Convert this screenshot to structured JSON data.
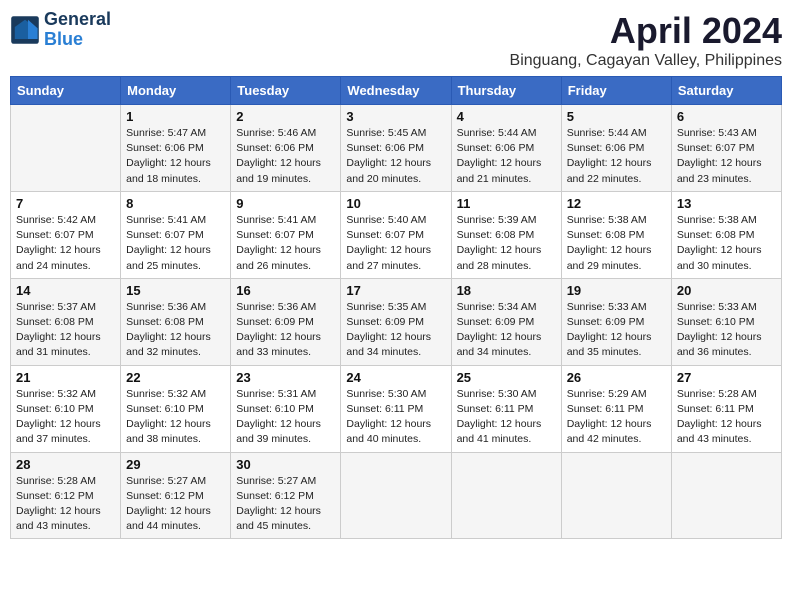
{
  "header": {
    "logo_line1": "General",
    "logo_line2": "Blue",
    "month": "April 2024",
    "location": "Binguang, Cagayan Valley, Philippines"
  },
  "days_of_week": [
    "Sunday",
    "Monday",
    "Tuesday",
    "Wednesday",
    "Thursday",
    "Friday",
    "Saturday"
  ],
  "weeks": [
    [
      {
        "date": "",
        "info": ""
      },
      {
        "date": "1",
        "info": "Sunrise: 5:47 AM\nSunset: 6:06 PM\nDaylight: 12 hours\nand 18 minutes."
      },
      {
        "date": "2",
        "info": "Sunrise: 5:46 AM\nSunset: 6:06 PM\nDaylight: 12 hours\nand 19 minutes."
      },
      {
        "date": "3",
        "info": "Sunrise: 5:45 AM\nSunset: 6:06 PM\nDaylight: 12 hours\nand 20 minutes."
      },
      {
        "date": "4",
        "info": "Sunrise: 5:44 AM\nSunset: 6:06 PM\nDaylight: 12 hours\nand 21 minutes."
      },
      {
        "date": "5",
        "info": "Sunrise: 5:44 AM\nSunset: 6:06 PM\nDaylight: 12 hours\nand 22 minutes."
      },
      {
        "date": "6",
        "info": "Sunrise: 5:43 AM\nSunset: 6:07 PM\nDaylight: 12 hours\nand 23 minutes."
      }
    ],
    [
      {
        "date": "7",
        "info": "Sunrise: 5:42 AM\nSunset: 6:07 PM\nDaylight: 12 hours\nand 24 minutes."
      },
      {
        "date": "8",
        "info": "Sunrise: 5:41 AM\nSunset: 6:07 PM\nDaylight: 12 hours\nand 25 minutes."
      },
      {
        "date": "9",
        "info": "Sunrise: 5:41 AM\nSunset: 6:07 PM\nDaylight: 12 hours\nand 26 minutes."
      },
      {
        "date": "10",
        "info": "Sunrise: 5:40 AM\nSunset: 6:07 PM\nDaylight: 12 hours\nand 27 minutes."
      },
      {
        "date": "11",
        "info": "Sunrise: 5:39 AM\nSunset: 6:08 PM\nDaylight: 12 hours\nand 28 minutes."
      },
      {
        "date": "12",
        "info": "Sunrise: 5:38 AM\nSunset: 6:08 PM\nDaylight: 12 hours\nand 29 minutes."
      },
      {
        "date": "13",
        "info": "Sunrise: 5:38 AM\nSunset: 6:08 PM\nDaylight: 12 hours\nand 30 minutes."
      }
    ],
    [
      {
        "date": "14",
        "info": "Sunrise: 5:37 AM\nSunset: 6:08 PM\nDaylight: 12 hours\nand 31 minutes."
      },
      {
        "date": "15",
        "info": "Sunrise: 5:36 AM\nSunset: 6:08 PM\nDaylight: 12 hours\nand 32 minutes."
      },
      {
        "date": "16",
        "info": "Sunrise: 5:36 AM\nSunset: 6:09 PM\nDaylight: 12 hours\nand 33 minutes."
      },
      {
        "date": "17",
        "info": "Sunrise: 5:35 AM\nSunset: 6:09 PM\nDaylight: 12 hours\nand 34 minutes."
      },
      {
        "date": "18",
        "info": "Sunrise: 5:34 AM\nSunset: 6:09 PM\nDaylight: 12 hours\nand 34 minutes."
      },
      {
        "date": "19",
        "info": "Sunrise: 5:33 AM\nSunset: 6:09 PM\nDaylight: 12 hours\nand 35 minutes."
      },
      {
        "date": "20",
        "info": "Sunrise: 5:33 AM\nSunset: 6:10 PM\nDaylight: 12 hours\nand 36 minutes."
      }
    ],
    [
      {
        "date": "21",
        "info": "Sunrise: 5:32 AM\nSunset: 6:10 PM\nDaylight: 12 hours\nand 37 minutes."
      },
      {
        "date": "22",
        "info": "Sunrise: 5:32 AM\nSunset: 6:10 PM\nDaylight: 12 hours\nand 38 minutes."
      },
      {
        "date": "23",
        "info": "Sunrise: 5:31 AM\nSunset: 6:10 PM\nDaylight: 12 hours\nand 39 minutes."
      },
      {
        "date": "24",
        "info": "Sunrise: 5:30 AM\nSunset: 6:11 PM\nDaylight: 12 hours\nand 40 minutes."
      },
      {
        "date": "25",
        "info": "Sunrise: 5:30 AM\nSunset: 6:11 PM\nDaylight: 12 hours\nand 41 minutes."
      },
      {
        "date": "26",
        "info": "Sunrise: 5:29 AM\nSunset: 6:11 PM\nDaylight: 12 hours\nand 42 minutes."
      },
      {
        "date": "27",
        "info": "Sunrise: 5:28 AM\nSunset: 6:11 PM\nDaylight: 12 hours\nand 43 minutes."
      }
    ],
    [
      {
        "date": "28",
        "info": "Sunrise: 5:28 AM\nSunset: 6:12 PM\nDaylight: 12 hours\nand 43 minutes."
      },
      {
        "date": "29",
        "info": "Sunrise: 5:27 AM\nSunset: 6:12 PM\nDaylight: 12 hours\nand 44 minutes."
      },
      {
        "date": "30",
        "info": "Sunrise: 5:27 AM\nSunset: 6:12 PM\nDaylight: 12 hours\nand 45 minutes."
      },
      {
        "date": "",
        "info": ""
      },
      {
        "date": "",
        "info": ""
      },
      {
        "date": "",
        "info": ""
      },
      {
        "date": "",
        "info": ""
      }
    ]
  ]
}
